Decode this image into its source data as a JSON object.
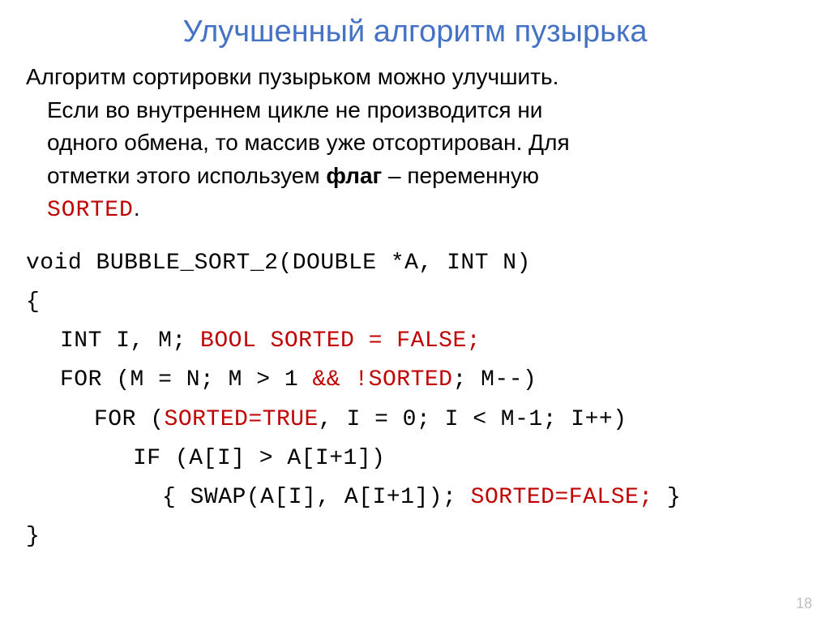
{
  "title": "Улучшенный алгоритм пузырька",
  "description": {
    "line1": "Алгоритм сортировки пузырьком можно улучшить.",
    "line2a": "Если во внутреннем цикле не производится ни",
    "line2b": "одного обмена, то массив уже отсортирован. Для",
    "line2c_prefix": "отметки этого используем ",
    "flag_bold": "флаг",
    "line2c_suffix": " – переменную",
    "sorted_kw": "SORTED",
    "period": "."
  },
  "code": {
    "l1": "void BUBBLE_SORT_2(DOUBLE *A, INT N)",
    "l2": "{",
    "l3a": "INT I, M; ",
    "l3b": "BOOL SORTED = FALSE;",
    "l4a": "FOR (M = N; M > 1 ",
    "l4b": "&& !SORTED",
    "l4c": "; M--)",
    "l5a": "FOR (",
    "l5b": "SORTED=TRUE",
    "l5c": ", I = 0; I < M-1; I++)",
    "l6": "IF (A[I] > A[I+1])",
    "l7a": "{ SWAP(A[I], A[I+1]); ",
    "l7b": "SORTED=FALSE;",
    "l7c": " }",
    "l8": "}"
  },
  "page_number": "18"
}
